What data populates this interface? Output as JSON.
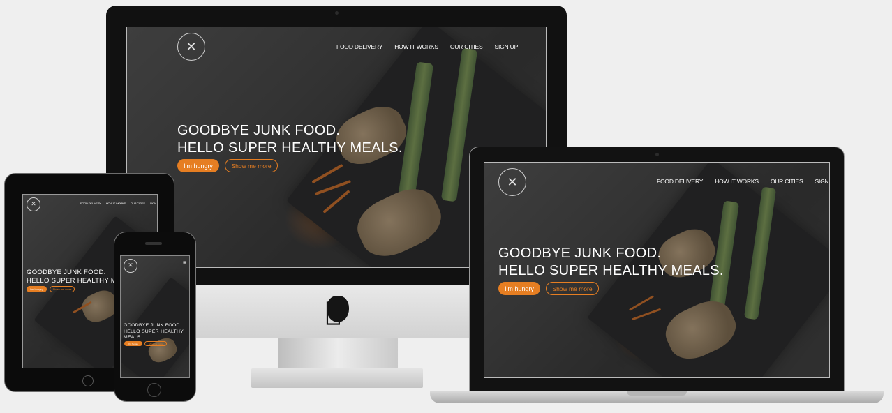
{
  "site": {
    "nav": [
      "FOOD DELIVERY",
      "HOW IT WORKS",
      "OUR CITIES",
      "SIGN UP"
    ],
    "headline_line1": "GOODBYE JUNK FOOD.",
    "headline_line2": "HELLO SUPER HEALTHY MEALS.",
    "phone_line1": "GOODBYE JUNK FOOD.",
    "phone_line2": "HELLO SUPER HEALTHY",
    "phone_line3": "MEALS.",
    "btn_primary": "I'm hungry",
    "btn_secondary": "Show me more",
    "menu_icon": "hamburger-menu-icon",
    "logo_icon": "fork-knife-logo-icon",
    "accent_color": "#e67e22"
  },
  "devices": [
    "desktop-monitor",
    "laptop",
    "tablet",
    "phone"
  ],
  "brand_icon": "apple-logo-icon"
}
